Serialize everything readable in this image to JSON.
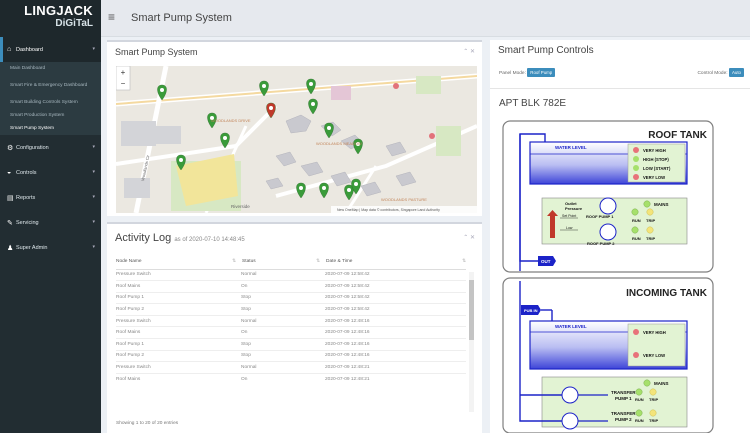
{
  "brand": {
    "line1": "LINGJACK",
    "line2": "DiGiTaL"
  },
  "topbar": {
    "title": "Smart Pump System"
  },
  "sidebar": {
    "dashboard": "Dashboard",
    "sub": [
      "Main Dashboard",
      "Smart Fire & Emergency Dashboard",
      "Smart Building Controls System",
      "Smart Production System",
      "Smart Pump System"
    ],
    "items": [
      "Configuration",
      "Controls",
      "Reports",
      "Servicing",
      "Super Admin"
    ]
  },
  "map_panel": {
    "title": "Smart Pump System",
    "labels": [
      "WOODLANDS DRIVE",
      "WOODLANDS MEADOW",
      "WOODLANDS PASTURE",
      "Riverside",
      "Woodlands Cir"
    ],
    "attribution": "New OneMap | Map data © contributors, Singapore Land Authority"
  },
  "activity": {
    "title": "Activity Log",
    "subtitle": "as of 2020-07-10 14:48:45",
    "columns": [
      "Node Name",
      "Status",
      "Date & Time"
    ],
    "rows": [
      [
        "Pressure Switch",
        "Normal",
        "2020-07-09 12:58:42"
      ],
      [
        "Roof Mains",
        "On",
        "2020-07-09 12:58:42"
      ],
      [
        "Roof Pump 1",
        "Stop",
        "2020-07-09 12:58:42"
      ],
      [
        "Roof Pump 2",
        "Stop",
        "2020-07-09 12:58:42"
      ],
      [
        "Pressure Switch",
        "Normal",
        "2020-07-09 12:48:16"
      ],
      [
        "Roof Mains",
        "On",
        "2020-07-09 12:48:16"
      ],
      [
        "Roof Pump 1",
        "Stop",
        "2020-07-09 12:48:16"
      ],
      [
        "Roof Pump 2",
        "Stop",
        "2020-07-09 12:48:16"
      ],
      [
        "Pressure Switch",
        "Normal",
        "2020-07-09 12:48:21"
      ],
      [
        "Roof Mains",
        "On",
        "2020-07-09 12:48:21"
      ]
    ],
    "footer": "Showing 1 to 20 of 20 entries"
  },
  "controls": {
    "title": "Smart Pump Controls",
    "panel_mode_label": "Panel Mode:",
    "panel_mode_value": "Roof Pump",
    "control_mode_label": "Control Mode:",
    "control_mode_value": "Auto",
    "building": "APT BLK 782E"
  },
  "roof_tank": {
    "title": "ROOF TANK",
    "water_level": "WATER LEVEL",
    "levels": [
      "VERY HIGH",
      "HIGH (STOP)",
      "LOW (START)",
      "VERY LOW"
    ],
    "outlet_pressure": "Outlet Pressure",
    "set_point": "Set Point",
    "low": "Low",
    "pump1": "ROOF PUMP 1",
    "pump2": "ROOF PUMP 2",
    "mains": "MAINS",
    "run": "RUN",
    "trip": "TRIP",
    "out": "OUT"
  },
  "incoming_tank": {
    "title": "INCOMING TANK",
    "pub_in": "PUB IN",
    "water_level": "WATER LEVEL",
    "levels": [
      "VERY HIGH",
      "VERY LOW"
    ],
    "mains": "MAINS",
    "pump1": "TRANSFER PUMP 1",
    "pump2": "TRANSFER PUMP 2",
    "run": "RUN",
    "trip": "TRIP"
  },
  "colors": {
    "accent": "#3c8dbc",
    "pin": "#3a9b3a",
    "pin_alert": "#c0392b",
    "pipe": "#1c23c8",
    "tank": "#3d44d8",
    "panel_green": "#e2f3d3"
  }
}
